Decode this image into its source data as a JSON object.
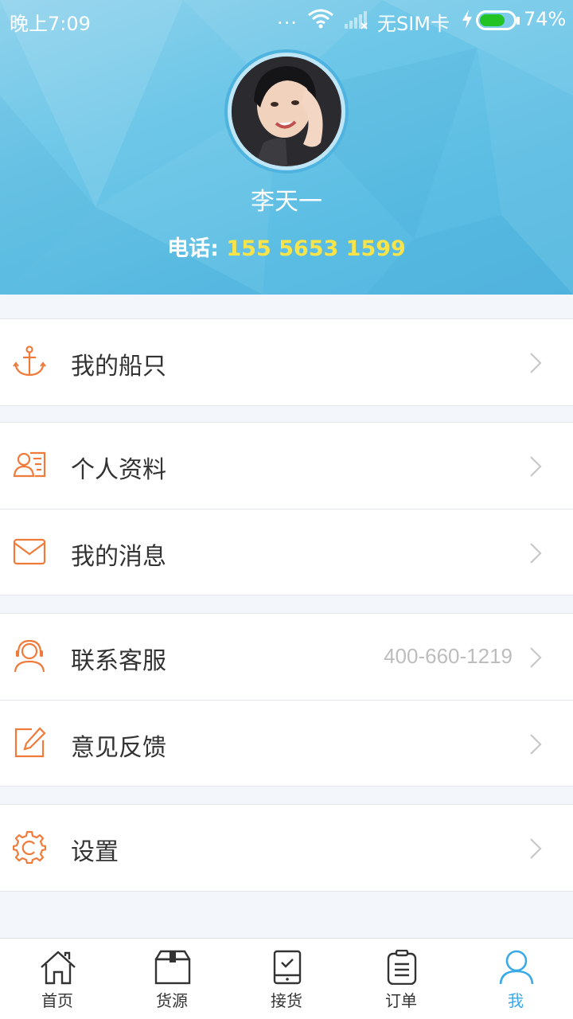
{
  "status_bar": {
    "time": "晚上7:09",
    "dots": "...",
    "carrier": "无SIM卡",
    "battery": "74%",
    "battery_level": 0.74
  },
  "profile": {
    "name": "李天一",
    "phone_label": "电话:",
    "phone_number": "155 5653 1599"
  },
  "menu": {
    "my_ships": {
      "label": "我的船只",
      "icon": "anchor-icon"
    },
    "profile_info": {
      "label": "个人资料",
      "icon": "id-card-icon"
    },
    "messages": {
      "label": "我的消息",
      "icon": "envelope-icon"
    },
    "customer_service": {
      "label": "联系客服",
      "value": "400-660-1219",
      "icon": "headset-icon"
    },
    "feedback": {
      "label": "意见反馈",
      "icon": "edit-icon"
    },
    "settings": {
      "label": "设置",
      "icon": "gear-icon"
    }
  },
  "tabs": [
    {
      "label": "首页",
      "icon": "home-icon"
    },
    {
      "label": "货源",
      "icon": "box-icon"
    },
    {
      "label": "接货",
      "icon": "tablet-check-icon"
    },
    {
      "label": "订单",
      "icon": "clipboard-icon"
    },
    {
      "label": "我",
      "icon": "user-icon",
      "active": true
    }
  ],
  "colors": {
    "accent_orange": "#f07a3a",
    "active_tab": "#3aa9e8",
    "phone_highlight": "#f7e44a",
    "header_blue": "#5bbde3"
  }
}
